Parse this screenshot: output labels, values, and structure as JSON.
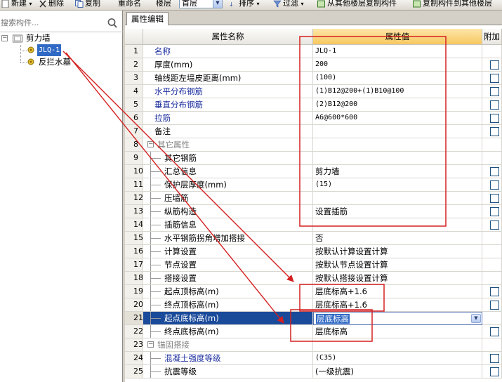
{
  "toolbar": {
    "items": [
      "新建",
      "删除",
      "复制",
      "重命名",
      "楼层",
      "首层",
      "排序",
      "过滤",
      "从其他楼层复制构件",
      "复制构件到其他楼层"
    ]
  },
  "left_panel": {
    "search": {
      "placeholder": "搜索构件..."
    },
    "tree": {
      "root": {
        "label": "剪力墙"
      },
      "children": [
        {
          "label": "JLQ-1",
          "selected": true
        },
        {
          "label": "反拦水墓"
        }
      ]
    }
  },
  "tab": {
    "label": "属性编辑"
  },
  "grid": {
    "headers": {
      "name": "属性名称",
      "value": "属性值",
      "extra": "附加"
    },
    "rows": [
      {
        "num": "1",
        "name": "名称",
        "value": "JLQ-1",
        "style": "blue",
        "checkbox": false,
        "tree": false
      },
      {
        "num": "2",
        "name": "厚度(mm)",
        "value": "200",
        "style": "normal",
        "checkbox": true,
        "tree": false
      },
      {
        "num": "3",
        "name": "轴线距左墙皮距离(mm)",
        "value": "(100)",
        "style": "normal",
        "checkbox": true,
        "tree": false
      },
      {
        "num": "4",
        "name": "水平分布钢筋",
        "value": "(1)B12@200+(1)B10@100",
        "style": "blue",
        "checkbox": true,
        "tree": false
      },
      {
        "num": "5",
        "name": "垂直分布钢筋",
        "value": "(2)B12@200",
        "style": "blue",
        "checkbox": true,
        "tree": false
      },
      {
        "num": "6",
        "name": "拉筋",
        "value": "A6@600*600",
        "style": "blue",
        "checkbox": true,
        "tree": false
      },
      {
        "num": "7",
        "name": "备注",
        "value": "",
        "style": "normal",
        "checkbox": true,
        "tree": false
      },
      {
        "num": "8",
        "name": "其它属性",
        "value": "",
        "style": "grey",
        "checkbox": false,
        "tree": "group"
      },
      {
        "num": "9",
        "name": "其它钢筋",
        "value": "",
        "style": "normal",
        "checkbox": false,
        "tree": "child"
      },
      {
        "num": "10",
        "name": "汇总信息",
        "value": "剪力墙",
        "style": "normal",
        "checkbox": true,
        "tree": "child"
      },
      {
        "num": "11",
        "name": "保护层厚度(mm)",
        "value": "(15)",
        "style": "normal",
        "checkbox": true,
        "tree": "child"
      },
      {
        "num": "12",
        "name": "压墙筋",
        "value": "",
        "style": "normal",
        "checkbox": true,
        "tree": "child"
      },
      {
        "num": "13",
        "name": "纵筋构造",
        "value": "设置插筋",
        "style": "normal",
        "checkbox": true,
        "tree": "child"
      },
      {
        "num": "14",
        "name": "插筋信息",
        "value": "",
        "style": "normal",
        "checkbox": true,
        "tree": "child"
      },
      {
        "num": "15",
        "name": "水平钢筋拐角增加搭接",
        "value": "否",
        "style": "normal",
        "checkbox": false,
        "tree": "child"
      },
      {
        "num": "16",
        "name": "计算设置",
        "value": "按默认计算设置计算",
        "style": "normal",
        "checkbox": false,
        "tree": "child"
      },
      {
        "num": "17",
        "name": "节点设置",
        "value": "按默认节点设置计算",
        "style": "normal",
        "checkbox": false,
        "tree": "child"
      },
      {
        "num": "18",
        "name": "搭接设置",
        "value": "按默认搭接设置计算",
        "style": "normal",
        "checkbox": false,
        "tree": "child"
      },
      {
        "num": "19",
        "name": "起点顶标高(m)",
        "value": "层底标高+1.6",
        "style": "normal",
        "checkbox": true,
        "tree": "child"
      },
      {
        "num": "20",
        "name": "终点顶标高(m)",
        "value": "层底标高+1.6",
        "style": "normal",
        "checkbox": true,
        "tree": "child"
      },
      {
        "num": "21",
        "name": "起点底标高(m)",
        "value": "层底标高",
        "style": "selected",
        "checkbox": false,
        "tree": "child"
      },
      {
        "num": "22",
        "name": "终点底标高(m)",
        "value": "层底标高",
        "style": "normal",
        "checkbox": true,
        "tree": "child"
      },
      {
        "num": "23",
        "name": "锚固搭接",
        "value": "",
        "style": "grey",
        "checkbox": false,
        "tree": "group"
      },
      {
        "num": "24",
        "name": "混凝土强度等级",
        "value": "(C35)",
        "style": "blue",
        "checkbox": true,
        "tree": "child"
      },
      {
        "num": "25",
        "name": "抗震等级",
        "value": "(一级抗震)",
        "style": "normal",
        "checkbox": true,
        "tree": "child"
      }
    ]
  },
  "annotation_color": "#d42020"
}
